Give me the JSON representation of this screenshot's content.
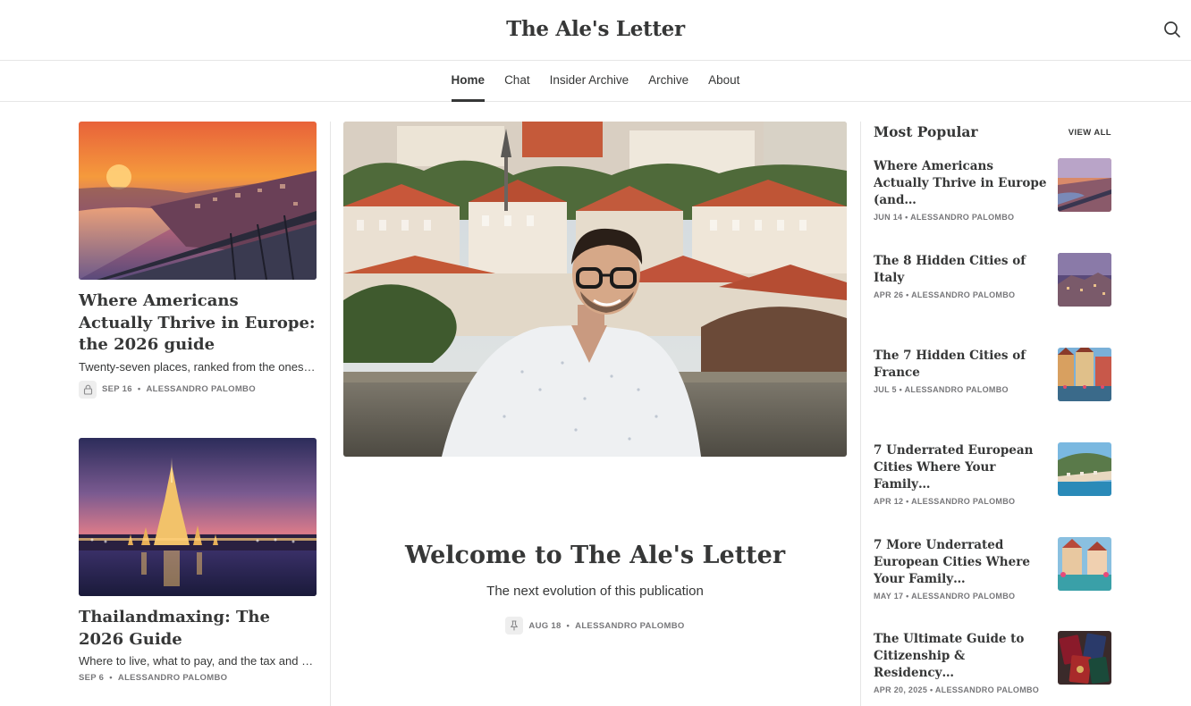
{
  "header": {
    "title": "The Ale's Letter",
    "search_icon": "search-icon"
  },
  "nav": {
    "items": [
      {
        "label": "Home",
        "active": true
      },
      {
        "label": "Chat"
      },
      {
        "label": "Insider Archive"
      },
      {
        "label": "Archive"
      },
      {
        "label": "About"
      }
    ]
  },
  "left_posts": [
    {
      "title": "Where Americans Actually Thrive in Europe: the 2026 guide",
      "subtitle": "Twenty-seven places, ranked from the ones Americans love most to the ones they love least",
      "date": "SEP 16",
      "author": "ALESSANDRO PALOMBO",
      "icon": "lock-icon"
    },
    {
      "title": "Thailandmaxing: The 2026 Guide",
      "subtitle": "Where to live, what to pay, and the tax and visa rules that actually matter",
      "date": "SEP 6",
      "author": "ALESSANDRO PALOMBO"
    }
  ],
  "hero": {
    "title": "Welcome to The Ale's Letter",
    "subtitle": "The next evolution of this publication",
    "date": "AUG 18",
    "author": "ALESSANDRO PALOMBO",
    "icon": "pin-icon"
  },
  "popular": {
    "heading": "Most Popular",
    "view_all": "VIEW ALL",
    "items": [
      {
        "title": "Where Americans Actually Thrive in Europe (and…",
        "date": "JUN 14",
        "author": "ALESSANDRO PALOMBO"
      },
      {
        "title": "The 8 Hidden Cities of Italy",
        "date": "APR 26",
        "author": "ALESSANDRO PALOMBO"
      },
      {
        "title": "The 7 Hidden Cities of France",
        "date": "JUL 5",
        "author": "ALESSANDRO PALOMBO"
      },
      {
        "title": "7 Underrated European Cities Where Your Family…",
        "date": "APR 12",
        "author": "ALESSANDRO PALOMBO"
      },
      {
        "title": "7 More Underrated European Cities Where Your Family…",
        "date": "MAY 17",
        "author": "ALESSANDRO PALOMBO"
      },
      {
        "title": "The Ultimate Guide to Citizenship & Residency…",
        "date": "APR 20, 2025",
        "author": "ALESSANDRO PALOMBO"
      }
    ]
  },
  "separator": "•",
  "colors": {
    "text": "#363737",
    "meta": "#77777a",
    "border": "#e6e6e6"
  }
}
